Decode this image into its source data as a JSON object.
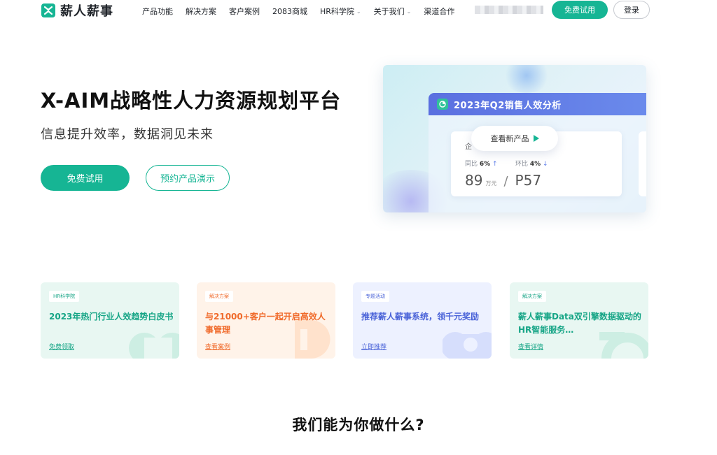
{
  "brand": {
    "name": "薪人薪事",
    "color": "#16b594"
  },
  "nav": {
    "items": [
      {
        "label": "产品功能",
        "has_dropdown": false
      },
      {
        "label": "解决方案",
        "has_dropdown": false
      },
      {
        "label": "客户案例",
        "has_dropdown": false
      },
      {
        "label": "2083商城",
        "has_dropdown": false
      },
      {
        "label": "HR科学院",
        "has_dropdown": true
      },
      {
        "label": "关于我们",
        "has_dropdown": true
      },
      {
        "label": "渠道合作",
        "has_dropdown": false
      }
    ],
    "trial_label": "免费试用",
    "login_label": "登录"
  },
  "hero": {
    "title": "X-AIM战略性人力资源规划平台",
    "subtitle": "信息提升效率，数据洞见未来",
    "trial_label": "免费试用",
    "demo_label": "预约产品演示",
    "visual": {
      "panel_title": "2023年Q2销售人效分析",
      "stat_label": "企",
      "yoy_label": "同比",
      "yoy_value": "6%",
      "mom_label": "环比",
      "mom_value": "4%",
      "main_value": "89",
      "main_unit": "万元",
      "secondary_value": "P57",
      "cta_label": "查看新产品"
    }
  },
  "cards": [
    {
      "tag": "HR科学院",
      "title": "2023年热门行业人效趋势白皮书",
      "link": "免费领取"
    },
    {
      "tag": "解决方案",
      "title": "与21000+客户一起开启高效人事管理",
      "link": "查看案例"
    },
    {
      "tag": "专题活动",
      "title": "推荐薪人薪事系统，领千元奖励",
      "link": "立即推荐"
    },
    {
      "tag": "解决方案",
      "title": "薪人薪事Data双引擎数据驱动的HR智能服务…",
      "link": "查看详情"
    }
  ],
  "section": {
    "title": "我们能为你做什么?"
  }
}
